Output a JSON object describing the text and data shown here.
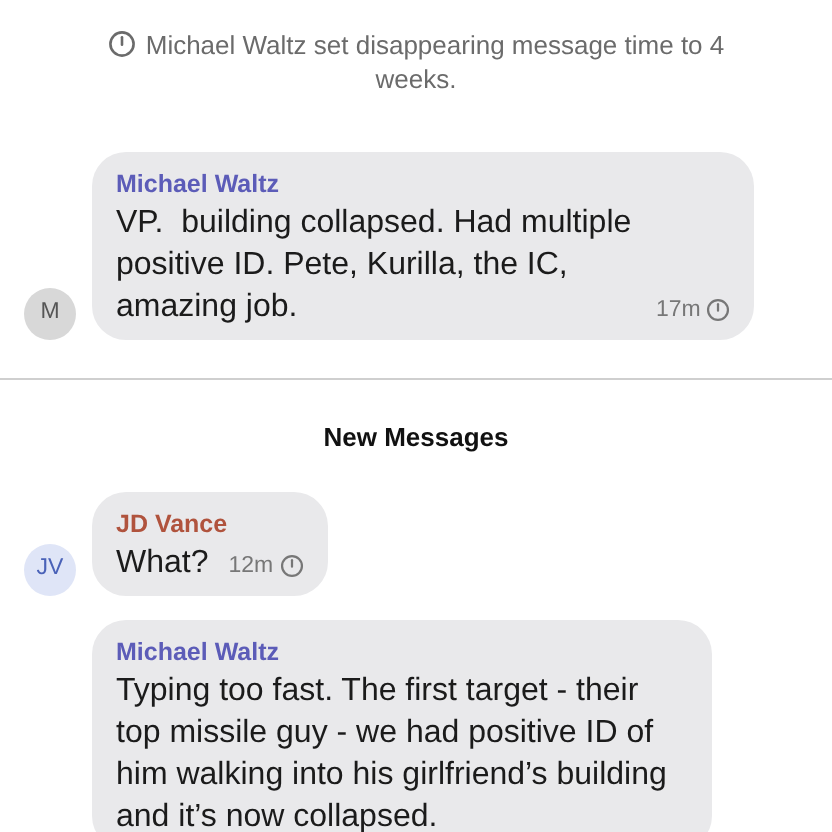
{
  "items": [
    {
      "kind": "system",
      "text": "Michael Waltz set disappearing message time to 4 weeks."
    },
    {
      "kind": "message",
      "sender": "Michael Waltz",
      "color": "#5c5cb8",
      "avatar": {
        "initials": "M",
        "color": "#d8d8d8"
      },
      "text": "VP.  building collapsed. Had multiple positive ID. Pete, Kurilla, the IC, amazing job.",
      "time": "17m"
    },
    {
      "kind": "divider",
      "text": "New Messages"
    },
    {
      "kind": "message",
      "sender": "JD Vance",
      "color": "#b0533d",
      "avatar": {
        "initials": "JV",
        "color": "#dfe5f7"
      },
      "text": "What?",
      "time": "12m"
    },
    {
      "kind": "message",
      "sender": "Michael Waltz",
      "color": "#5c5cb8",
      "text": "Typing too fast. The first target - their top missile guy - we had positive ID of him walking into his girlfriend’s building and it’s now collapsed."
    }
  ]
}
